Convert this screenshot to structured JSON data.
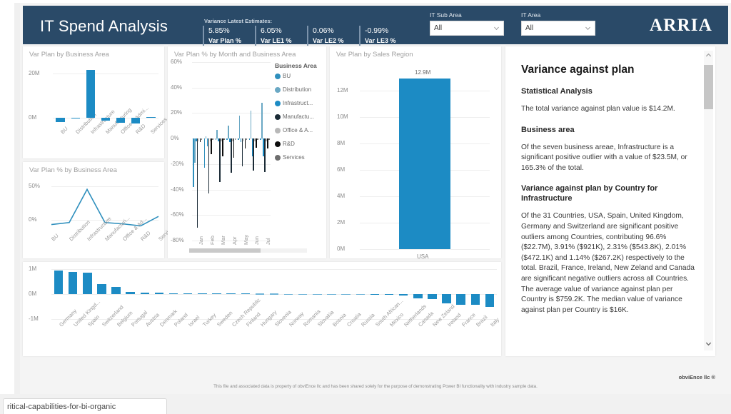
{
  "header": {
    "title": "IT Spend Analysis",
    "kpi_caption": "Variance Latest Estimates:",
    "kpis": [
      {
        "value": "5.85%",
        "label": "Var Plan %"
      },
      {
        "value": "6.05%",
        "label": "Var LE1 %"
      },
      {
        "value": "0.06%",
        "label": "Var LE2 %"
      },
      {
        "value": "-0.99%",
        "label": "Var LE3 %"
      }
    ],
    "slicers": [
      {
        "label": "IT Sub Area",
        "value": "All"
      },
      {
        "label": "IT Area",
        "value": "All"
      }
    ],
    "brand": "ARRIA",
    "bg_color": "#2a4a68"
  },
  "chart_data": [
    {
      "id": "var_plan_by_business_area",
      "type": "bar",
      "title": "Var Plan by Business Area",
      "categories": [
        "BU",
        "Distribution",
        "Infrastructure",
        "Manufacturing",
        "Office & Admi...",
        "R&D",
        "Services"
      ],
      "values": [
        -2.1,
        -0.4,
        21.8,
        -1.3,
        -2.4,
        -2.8,
        0.3
      ],
      "ytick_labels": [
        "20M",
        "0M"
      ],
      "ytick_values": [
        20,
        0
      ],
      "ylim": [
        -4,
        24
      ],
      "xlabel": "",
      "ylabel": "",
      "grid": true,
      "color": "#1c8bc4"
    },
    {
      "id": "var_plan_pct_by_business_area",
      "type": "line",
      "title": "Var Plan % by Business Area",
      "categories": [
        "BU",
        "Distribution",
        "Infrastructure",
        "Manufacturi...",
        "Office & Ad...",
        "R&D",
        "Services"
      ],
      "values": [
        -7,
        -4,
        45,
        -4,
        -6,
        -9,
        5
      ],
      "ytick_labels": [
        "50%",
        "0%"
      ],
      "ytick_values": [
        50,
        0
      ],
      "ylim": [
        -18,
        58
      ],
      "xlabel": "",
      "ylabel": "",
      "grid": true,
      "color": "#2e8fbd"
    },
    {
      "id": "var_plan_pct_by_month_and_business_area",
      "type": "bar",
      "title": "Var Plan % by Month and Business Area",
      "legend_title": "Business Area",
      "legend_position": "right",
      "categories": [
        "Jan",
        "Feb",
        "Mar",
        "Apr",
        "May",
        "Jun",
        "Jul"
      ],
      "ytick_labels": [
        "60%",
        "40%",
        "20%",
        "0%",
        "-20%",
        "-40%",
        "-60%",
        "-80%"
      ],
      "ytick_values": [
        60,
        40,
        20,
        0,
        -20,
        -40,
        -60,
        -80
      ],
      "ylim": [
        -80,
        60
      ],
      "series": [
        {
          "name": "BU",
          "color": "#2e8fbd",
          "values": [
            -38,
            -23,
            -1,
            -1,
            -1,
            -1,
            -1
          ]
        },
        {
          "name": "Distribution",
          "color": "#6aa8c4",
          "values": [
            -19,
            2,
            7,
            10,
            18,
            22,
            28
          ]
        },
        {
          "name": "Infrastruct...",
          "color": "#1c8bc4",
          "values": [
            -2,
            -6,
            -2,
            -3,
            -3,
            -14,
            -14
          ]
        },
        {
          "name": "Manufactu...",
          "color": "#1b2b36",
          "values": [
            -70,
            -43,
            -34,
            -27,
            -22,
            -25,
            -26
          ]
        },
        {
          "name": "Office & A...",
          "color": "#b8b8b8",
          "values": [
            -2,
            -2,
            -2,
            -2,
            -2,
            -2,
            -2
          ]
        },
        {
          "name": "R&D",
          "color": "#0d0d0d",
          "values": [
            -3,
            -12,
            -14,
            -15,
            -8,
            -7,
            -8
          ]
        },
        {
          "name": "Services",
          "color": "#6e6e6e",
          "values": [
            -1,
            -1,
            -1,
            -1,
            -1,
            -1,
            -1
          ]
        }
      ],
      "grid": true,
      "scrollbar": "horizontal"
    },
    {
      "id": "var_plan_by_sales_region",
      "type": "bar",
      "title": "Var Plan by Sales Region",
      "categories": [
        "USA"
      ],
      "values": [
        12.9
      ],
      "data_labels": [
        "12.9M"
      ],
      "ytick_labels": [
        "12M",
        "10M",
        "8M",
        "6M",
        "4M",
        "2M",
        "0M"
      ],
      "ytick_values": [
        12,
        10,
        8,
        6,
        4,
        2,
        0
      ],
      "ylim": [
        0,
        13.6
      ],
      "grid": true,
      "color": "#1c8bc4"
    },
    {
      "id": "var_plan_by_country",
      "type": "bar",
      "title": "",
      "categories": [
        "Germany",
        "United Kingd...",
        "Spain",
        "Switzerland",
        "Belgium",
        "Portugal",
        "Austria",
        "Denmark",
        "Poland",
        "Israel",
        "Turkey",
        "Sweden",
        "Czech Republic",
        "Finland",
        "Hungary",
        "Slovenia",
        "Norway",
        "Romania",
        "Slovakia",
        "Bosnia",
        "Croatia",
        "Russia",
        "South African...",
        "Mexico",
        "Netherlands",
        "Canada",
        "New Zeland",
        "Ireland",
        "France",
        "Brazil",
        "Italy"
      ],
      "values": [
        0.93,
        0.88,
        0.85,
        0.4,
        0.28,
        0.09,
        0.06,
        0.045,
        0.04,
        0.035,
        0.03,
        0.028,
        0.025,
        0.02,
        0.018,
        0.015,
        0.012,
        0.01,
        0.008,
        0.006,
        0.004,
        0.002,
        -0.02,
        -0.04,
        -0.06,
        -0.18,
        -0.2,
        -0.38,
        -0.42,
        -0.44,
        -0.52
      ],
      "ytick_labels": [
        "1M",
        "0M",
        "-1M"
      ],
      "ytick_values": [
        1,
        0,
        -1
      ],
      "ylim": [
        -1,
        1
      ],
      "grid": true,
      "color": "#1c8bc4"
    }
  ],
  "narrative": {
    "heading": "Variance against plan",
    "sections": [
      {
        "kind": "h2",
        "text": "Statistical Analysis"
      },
      {
        "kind": "p",
        "text": "The total variance against plan value is $14.2M."
      },
      {
        "kind": "h2",
        "text": "Business area"
      },
      {
        "kind": "p",
        "text": "Of the seven business areae, Infrastructure is a significant positive outlier with a value of $23.5M, or 165.3% of the total."
      },
      {
        "kind": "h2",
        "text": "Variance against plan by Country for Infrastructure"
      },
      {
        "kind": "p",
        "text": "Of the 31 Countries, USA, Spain, United Kingdom, Germany and Switzerland are significant positive outliers among Countries, contributing 96.6% ($22.7M), 3.91% ($921K), 2.31% ($543.8K), 2.01% ($472.1K) and 1.14% ($267.2K) respectively to the total. Brazil, France, Ireland, New Zeland and Canada are significant negative outliers across all Countries. The average value of variance against plan per Country is $759.2K. The median value of variance against plan per Country is $16K."
      }
    ]
  },
  "footer": {
    "brand": "obviEnce llc ®",
    "note": "This file and associated data is property of obviEnce llc and has been shared solely for the purpose of demonstrating Power BI functionality with industry sample data."
  },
  "browser": {
    "tab_label": "ritical-capabilities-for-bi-organic"
  }
}
